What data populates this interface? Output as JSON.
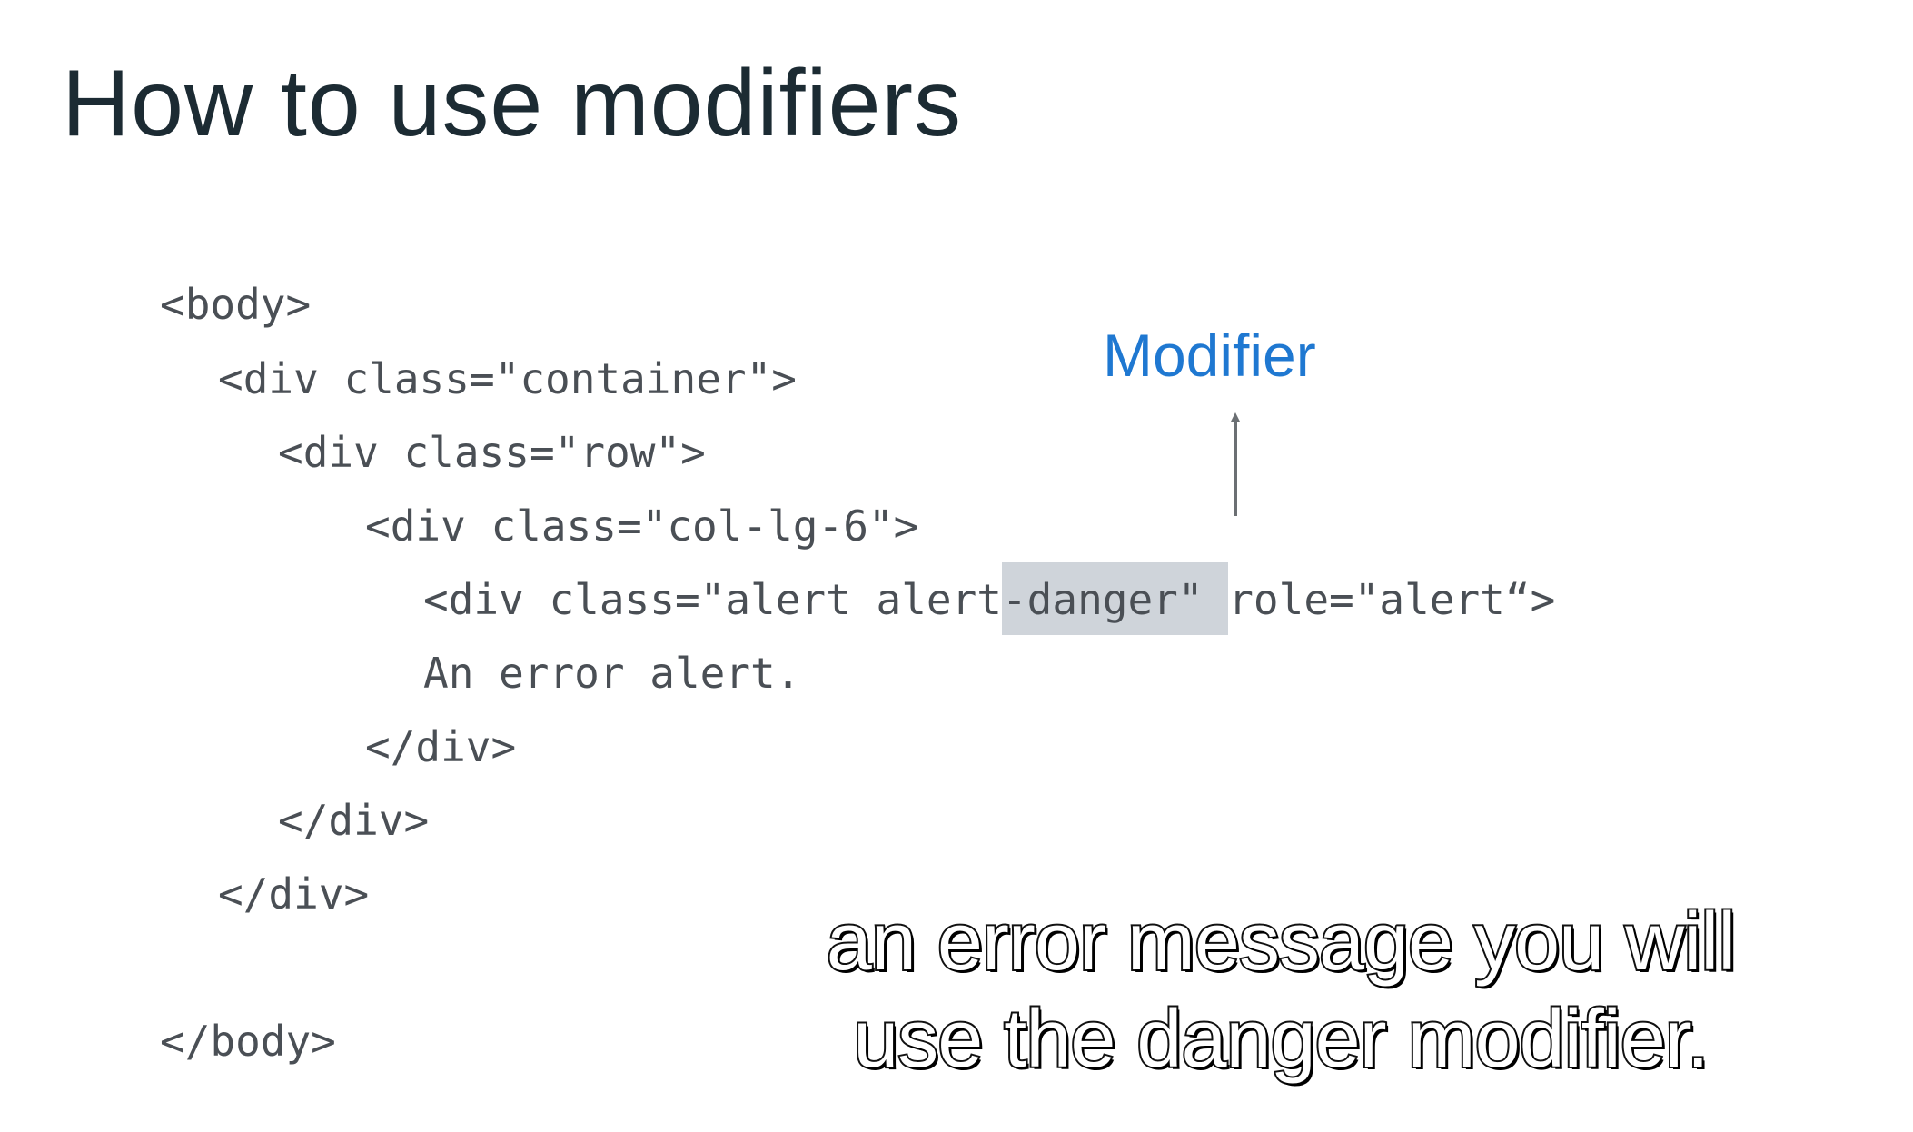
{
  "slide": {
    "title": "How to use modifiers",
    "code": {
      "line1": "<body>",
      "line2": "<div class=\"container\">",
      "line3": "<div class=\"row\">",
      "line4": "<div class=\"col-lg-6\">",
      "line5_before": "<div class=\"alert alert",
      "line5_highlight": "-danger\" ",
      "line5_after": "role=\"alert“>",
      "line6": "An error alert.",
      "line7": "</div>",
      "line8": "</div>",
      "line9": "</div>",
      "line10": "</body>"
    },
    "annotation": {
      "label": "Modifier",
      "color": "#1f78d1",
      "highlight_color": "#cfd4da"
    }
  },
  "caption": {
    "line1": "an error message you will",
    "line2": "use the danger modifier."
  }
}
